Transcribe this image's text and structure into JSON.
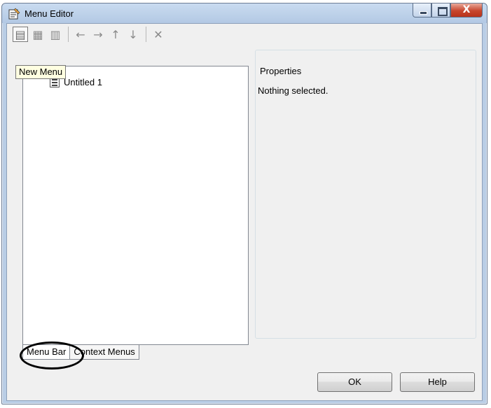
{
  "window": {
    "title": "Menu Editor",
    "close_glyph": "X"
  },
  "toolbar": {
    "buttons": [
      {
        "icon": "new-menu-icon",
        "glyph": "▤"
      },
      {
        "icon": "new-menu-item-icon",
        "glyph": "▦"
      },
      {
        "icon": "new-context-menu-icon",
        "glyph": "▥"
      },
      {
        "icon": "move-left-icon",
        "glyph": "←"
      },
      {
        "icon": "move-right-icon",
        "glyph": "→"
      },
      {
        "icon": "move-up-icon",
        "glyph": "↑"
      },
      {
        "icon": "move-down-icon",
        "glyph": "↓"
      },
      {
        "icon": "delete-icon",
        "glyph": "✕"
      }
    ]
  },
  "tooltip": "New Menu",
  "tree": {
    "items": [
      {
        "label": "Untitled 1"
      }
    ]
  },
  "tabs": [
    {
      "label": "Menu Bar",
      "selected": true
    },
    {
      "label": "Context Menus",
      "selected": false
    }
  ],
  "properties": {
    "legend": "Properties",
    "text": "Nothing selected."
  },
  "buttons": {
    "ok": "OK",
    "help": "Help"
  }
}
